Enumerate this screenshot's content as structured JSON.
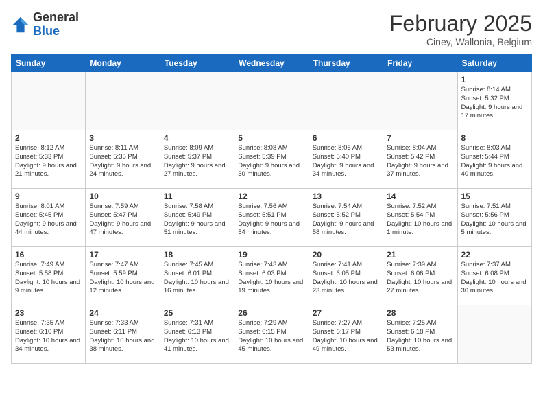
{
  "header": {
    "logo_general": "General",
    "logo_blue": "Blue",
    "month_title": "February 2025",
    "location": "Ciney, Wallonia, Belgium"
  },
  "weekdays": [
    "Sunday",
    "Monday",
    "Tuesday",
    "Wednesday",
    "Thursday",
    "Friday",
    "Saturday"
  ],
  "weeks": [
    [
      {
        "day": "",
        "info": ""
      },
      {
        "day": "",
        "info": ""
      },
      {
        "day": "",
        "info": ""
      },
      {
        "day": "",
        "info": ""
      },
      {
        "day": "",
        "info": ""
      },
      {
        "day": "",
        "info": ""
      },
      {
        "day": "1",
        "info": "Sunrise: 8:14 AM\nSunset: 5:32 PM\nDaylight: 9 hours and 17 minutes."
      }
    ],
    [
      {
        "day": "2",
        "info": "Sunrise: 8:12 AM\nSunset: 5:33 PM\nDaylight: 9 hours and 21 minutes."
      },
      {
        "day": "3",
        "info": "Sunrise: 8:11 AM\nSunset: 5:35 PM\nDaylight: 9 hours and 24 minutes."
      },
      {
        "day": "4",
        "info": "Sunrise: 8:09 AM\nSunset: 5:37 PM\nDaylight: 9 hours and 27 minutes."
      },
      {
        "day": "5",
        "info": "Sunrise: 8:08 AM\nSunset: 5:39 PM\nDaylight: 9 hours and 30 minutes."
      },
      {
        "day": "6",
        "info": "Sunrise: 8:06 AM\nSunset: 5:40 PM\nDaylight: 9 hours and 34 minutes."
      },
      {
        "day": "7",
        "info": "Sunrise: 8:04 AM\nSunset: 5:42 PM\nDaylight: 9 hours and 37 minutes."
      },
      {
        "day": "8",
        "info": "Sunrise: 8:03 AM\nSunset: 5:44 PM\nDaylight: 9 hours and 40 minutes."
      }
    ],
    [
      {
        "day": "9",
        "info": "Sunrise: 8:01 AM\nSunset: 5:45 PM\nDaylight: 9 hours and 44 minutes."
      },
      {
        "day": "10",
        "info": "Sunrise: 7:59 AM\nSunset: 5:47 PM\nDaylight: 9 hours and 47 minutes."
      },
      {
        "day": "11",
        "info": "Sunrise: 7:58 AM\nSunset: 5:49 PM\nDaylight: 9 hours and 51 minutes."
      },
      {
        "day": "12",
        "info": "Sunrise: 7:56 AM\nSunset: 5:51 PM\nDaylight: 9 hours and 54 minutes."
      },
      {
        "day": "13",
        "info": "Sunrise: 7:54 AM\nSunset: 5:52 PM\nDaylight: 9 hours and 58 minutes."
      },
      {
        "day": "14",
        "info": "Sunrise: 7:52 AM\nSunset: 5:54 PM\nDaylight: 10 hours and 1 minute."
      },
      {
        "day": "15",
        "info": "Sunrise: 7:51 AM\nSunset: 5:56 PM\nDaylight: 10 hours and 5 minutes."
      }
    ],
    [
      {
        "day": "16",
        "info": "Sunrise: 7:49 AM\nSunset: 5:58 PM\nDaylight: 10 hours and 9 minutes."
      },
      {
        "day": "17",
        "info": "Sunrise: 7:47 AM\nSunset: 5:59 PM\nDaylight: 10 hours and 12 minutes."
      },
      {
        "day": "18",
        "info": "Sunrise: 7:45 AM\nSunset: 6:01 PM\nDaylight: 10 hours and 16 minutes."
      },
      {
        "day": "19",
        "info": "Sunrise: 7:43 AM\nSunset: 6:03 PM\nDaylight: 10 hours and 19 minutes."
      },
      {
        "day": "20",
        "info": "Sunrise: 7:41 AM\nSunset: 6:05 PM\nDaylight: 10 hours and 23 minutes."
      },
      {
        "day": "21",
        "info": "Sunrise: 7:39 AM\nSunset: 6:06 PM\nDaylight: 10 hours and 27 minutes."
      },
      {
        "day": "22",
        "info": "Sunrise: 7:37 AM\nSunset: 6:08 PM\nDaylight: 10 hours and 30 minutes."
      }
    ],
    [
      {
        "day": "23",
        "info": "Sunrise: 7:35 AM\nSunset: 6:10 PM\nDaylight: 10 hours and 34 minutes."
      },
      {
        "day": "24",
        "info": "Sunrise: 7:33 AM\nSunset: 6:11 PM\nDaylight: 10 hours and 38 minutes."
      },
      {
        "day": "25",
        "info": "Sunrise: 7:31 AM\nSunset: 6:13 PM\nDaylight: 10 hours and 41 minutes."
      },
      {
        "day": "26",
        "info": "Sunrise: 7:29 AM\nSunset: 6:15 PM\nDaylight: 10 hours and 45 minutes."
      },
      {
        "day": "27",
        "info": "Sunrise: 7:27 AM\nSunset: 6:17 PM\nDaylight: 10 hours and 49 minutes."
      },
      {
        "day": "28",
        "info": "Sunrise: 7:25 AM\nSunset: 6:18 PM\nDaylight: 10 hours and 53 minutes."
      },
      {
        "day": "",
        "info": ""
      }
    ]
  ]
}
